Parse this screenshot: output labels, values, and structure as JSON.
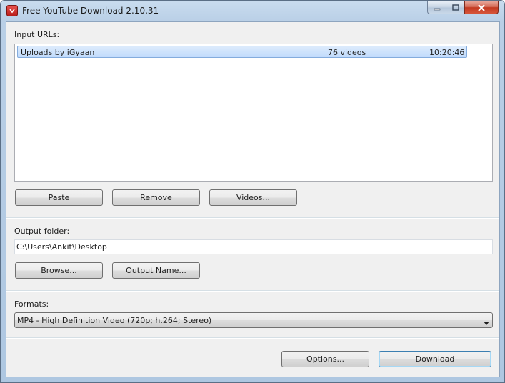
{
  "window": {
    "title": "Free YouTube Download 2.10.31"
  },
  "input_urls": {
    "label": "Input URLs:",
    "items": [
      {
        "name": "Uploads by iGyaan",
        "count": "76 videos",
        "duration": "10:20:46"
      }
    ]
  },
  "url_buttons": {
    "paste": "Paste",
    "remove": "Remove",
    "videos": "Videos..."
  },
  "output_folder": {
    "label": "Output folder:",
    "value": "C:\\Users\\Ankit\\Desktop",
    "browse": "Browse...",
    "output_name": "Output Name..."
  },
  "formats": {
    "label": "Formats:",
    "selected": "MP4 - High Definition Video (720p; h.264; Stereo)"
  },
  "footer": {
    "options": "Options...",
    "download": "Download"
  },
  "colors": {
    "selection": "#c1dbfc",
    "close_button": "#c33a21"
  }
}
